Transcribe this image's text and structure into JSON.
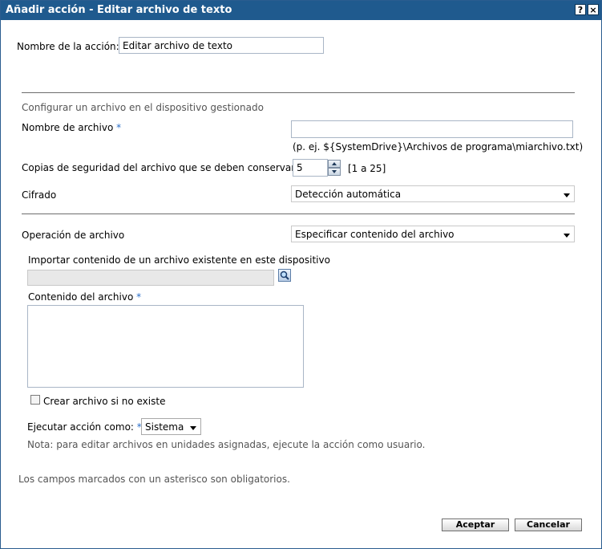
{
  "window": {
    "title": "Añadir acción - Editar archivo de texto",
    "help_label": "?",
    "close_label": "×"
  },
  "action_name": {
    "label": "Nombre de la acción:",
    "value": "Editar archivo de texto"
  },
  "section_title": "Configurar un archivo en el dispositivo gestionado",
  "file_name": {
    "label": "Nombre de archivo",
    "required_mark": "*",
    "value": "",
    "hint": "(p. ej. ${SystemDrive}\\Archivos de programa\\miarchivo.txt)"
  },
  "backups": {
    "label": "Copias de seguridad del archivo que se deben conservar",
    "value": "5",
    "range": "[1 a 25]"
  },
  "encoding": {
    "label": "Cifrado",
    "selected": "Detección automática"
  },
  "file_operation": {
    "label": "Operación de archivo",
    "selected": "Especificar contenido del archivo"
  },
  "import": {
    "label": "Importar contenido de un archivo existente en este dispositivo",
    "value": ""
  },
  "contents": {
    "label": "Contenido del archivo",
    "required_mark": "*",
    "value": ""
  },
  "create_if_missing": {
    "label": "Crear archivo si no existe",
    "checked": false
  },
  "run_as": {
    "label": "Ejecutar acción como:",
    "required_mark": "*",
    "selected": "Sistema",
    "note": "Nota: para editar archivos en unidades asignadas, ejecute la acción como usuario."
  },
  "required_note": "Los campos marcados con un asterisco son obligatorios.",
  "buttons": {
    "ok": "Aceptar",
    "cancel": "Cancelar"
  },
  "colors": {
    "titlebar": "#1f5a8e",
    "required": "#2a6ec9"
  }
}
